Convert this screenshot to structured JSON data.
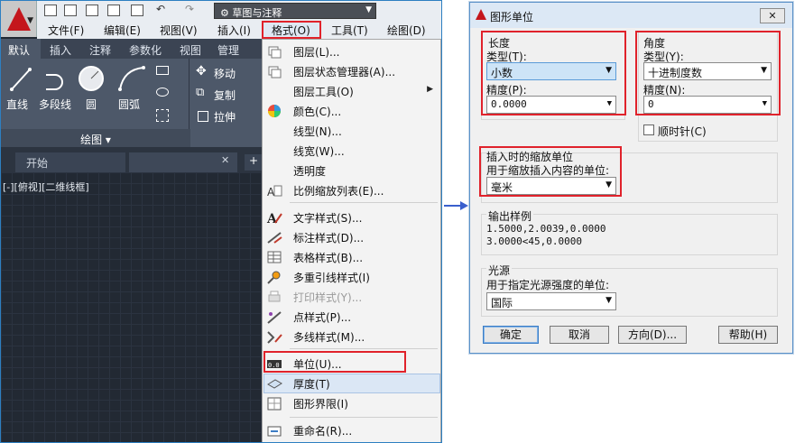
{
  "cad": {
    "workspace": "草图与注释",
    "menubar": [
      "文件(F)",
      "编辑(E)",
      "视图(V)",
      "插入(I)",
      "格式(O)",
      "工具(T)",
      "绘图(D)"
    ],
    "ribbon_tabs": [
      "默认",
      "插入",
      "注释",
      "参数化",
      "视图",
      "管理"
    ],
    "draw_tools": [
      "直线",
      "多段线",
      "圆",
      "圆弧"
    ],
    "modify_tools": [
      "移动",
      "复制",
      "拉伸"
    ],
    "panel_title": "绘图 ▾",
    "doc_tab": "开始",
    "doc_tab_close": "✕",
    "doc_tab_add": "+",
    "viewport_label": "[-][俯视][二维线框]"
  },
  "format_menu": {
    "items": [
      {
        "label": "图层(L)...",
        "icon": "layer-icon"
      },
      {
        "label": "图层状态管理器(A)...",
        "icon": "layer-state-icon"
      },
      {
        "label": "图层工具(O)",
        "icon": "none",
        "submenu": "▶"
      },
      {
        "label": "颜色(C)...",
        "icon": "color-wheel-icon"
      },
      {
        "label": "线型(N)...",
        "icon": "none"
      },
      {
        "label": "线宽(W)...",
        "icon": "none"
      },
      {
        "label": "透明度",
        "icon": "none"
      },
      {
        "label": "比例缩放列表(E)...",
        "icon": "scale-list-icon"
      },
      {
        "label": "文字样式(S)...",
        "icon": "text-style-icon"
      },
      {
        "label": "标注样式(D)...",
        "icon": "dim-style-icon"
      },
      {
        "label": "表格样式(B)...",
        "icon": "table-style-icon"
      },
      {
        "label": "多重引线样式(I)",
        "icon": "mleader-style-icon"
      },
      {
        "label": "打印样式(Y)...",
        "icon": "plot-style-icon",
        "disabled": true
      },
      {
        "label": "点样式(P)...",
        "icon": "point-style-icon"
      },
      {
        "label": "多线样式(M)...",
        "icon": "mline-style-icon"
      },
      {
        "label": "单位(U)...",
        "icon": "units-icon"
      },
      {
        "label": "厚度(T)",
        "icon": "thickness-icon"
      },
      {
        "label": "图形界限(I)",
        "icon": "limits-icon"
      },
      {
        "label": "重命名(R)...",
        "icon": "rename-icon"
      }
    ]
  },
  "dialog": {
    "title": "图形单位",
    "close": "✕",
    "length": {
      "group": "长度",
      "type_label": "类型(T):",
      "type_value": "小数",
      "precision_label": "精度(P):",
      "precision_value": "0.0000"
    },
    "angle": {
      "group": "角度",
      "type_label": "类型(Y):",
      "type_value": "十进制度数",
      "precision_label": "精度(N):",
      "precision_value": "0",
      "clockwise_label": "顺时针(C)",
      "clockwise_checked": false
    },
    "insertion": {
      "group": "插入时的缩放单位",
      "label": "用于缩放插入内容的单位:",
      "value": "毫米"
    },
    "sample": {
      "group": "输出样例",
      "line1": "1.5000,2.0039,0.0000",
      "line2": "3.0000<45,0.0000"
    },
    "lighting": {
      "group": "光源",
      "label": "用于指定光源强度的单位:",
      "value": "国际"
    },
    "buttons": {
      "ok": "确定",
      "cancel": "取消",
      "direction": "方向(D)...",
      "help": "帮助(H)"
    }
  },
  "colors": {
    "highlight_red": "#e0222b",
    "arrow_blue": "#3a5fcd",
    "autocad_red": "#c4161c"
  }
}
